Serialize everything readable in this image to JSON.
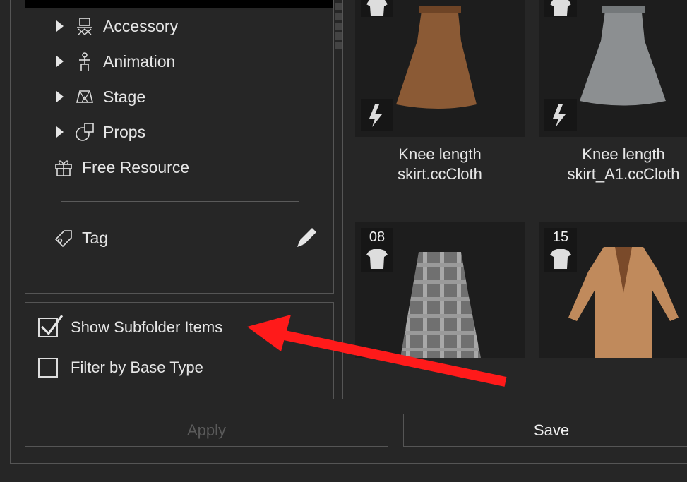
{
  "tree": {
    "items": [
      {
        "label": "Accessory",
        "icon": "accessory-icon",
        "expandable": true
      },
      {
        "label": "Animation",
        "icon": "animation-icon",
        "expandable": true
      },
      {
        "label": "Stage",
        "icon": "stage-icon",
        "expandable": true
      },
      {
        "label": "Props",
        "icon": "props-icon",
        "expandable": true
      },
      {
        "label": "Free Resource",
        "icon": "gift-icon",
        "expandable": false
      }
    ],
    "tag_label": "Tag"
  },
  "options": {
    "show_subfolder_label": "Show Subfolder Items",
    "show_subfolder_checked": true,
    "filter_base_type_label": "Filter by Base Type",
    "filter_base_type_checked": false
  },
  "grid": {
    "cards": [
      {
        "line1": "Knee length",
        "line2": "skirt.ccCloth",
        "badge": "",
        "thumb": "brown-skirt",
        "color": "#8b5a35"
      },
      {
        "line1": "Knee length",
        "line2": "skirt_A1.ccCloth",
        "badge": "",
        "thumb": "gray-skirt",
        "color": "#8c8f91"
      },
      {
        "line1": "",
        "line2": "",
        "badge": "08",
        "thumb": "plaid-skirt",
        "color": "#7a7a7a"
      },
      {
        "line1": "",
        "line2": "",
        "badge": "15",
        "thumb": "tan-coat",
        "color": "#c08a5c"
      }
    ]
  },
  "buttons": {
    "apply": "Apply",
    "save": "Save"
  },
  "annotation": {
    "color": "#ff1a1a"
  }
}
